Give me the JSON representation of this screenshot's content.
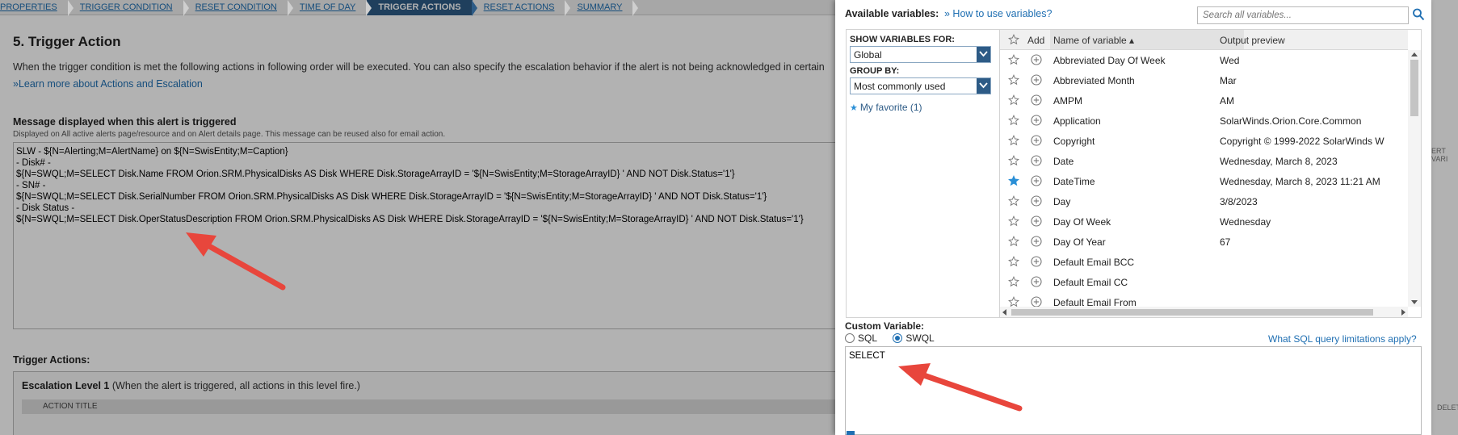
{
  "wizard_steps": [
    "PROPERTIES",
    "TRIGGER CONDITION",
    "RESET CONDITION",
    "TIME OF DAY",
    "TRIGGER ACTIONS",
    "RESET ACTIONS",
    "SUMMARY"
  ],
  "wizard_active": "TRIGGER ACTIONS",
  "page": {
    "title": "5. Trigger Action",
    "intro": "When the trigger condition is met the following actions in following order will be executed. You can also specify the escalation behavior if the alert is not being acknowledged in certain",
    "learn_link": "»Learn more about Actions and Escalation",
    "message_label": "Message displayed when this alert is triggered",
    "message_sub": "Displayed on All active alerts page/resource and on Alert details page. This message can be reused also for email action.",
    "message_lines": [
      "SLW - ${N=Alerting;M=AlertName} on ${N=SwisEntity;M=Caption}",
      "- Disk# -",
      "${N=SWQL;M=SELECT Disk.Name FROM Orion.SRM.PhysicalDisks AS Disk WHERE Disk.StorageArrayID = '${N=SwisEntity;M=StorageArrayID} ' AND NOT Disk.Status='1'}",
      "- SN# -",
      "${N=SWQL;M=SELECT Disk.SerialNumber FROM Orion.SRM.PhysicalDisks AS Disk WHERE Disk.StorageArrayID = '${N=SwisEntity;M=StorageArrayID} ' AND NOT Disk.Status='1'}",
      "- Disk Status -",
      "${N=SWQL;M=SELECT Disk.OperStatusDescription FROM Orion.SRM.PhysicalDisks AS Disk WHERE Disk.StorageArrayID = '${N=SwisEntity;M=StorageArrayID} ' AND NOT Disk.Status='1'}"
    ],
    "trigger_actions_label": "Trigger Actions:",
    "escalation_title": "Escalation Level 1",
    "escalation_note": "(When the alert is triggered, all actions in this level fire.)",
    "action_title_header": "ACTION TITLE",
    "right_peek_1": "ERT VARI",
    "right_peek_2": "DELETE"
  },
  "dialog": {
    "available_label": "Available variables:",
    "how_to_link": "» How to use variables?",
    "search_placeholder": "Search all variables...",
    "show_for_label": "SHOW VARIABLES FOR:",
    "show_for_value": "Global",
    "group_by_label": "GROUP BY:",
    "group_by_value": "Most commonly used",
    "favorite": "My favorite (1)",
    "columns": {
      "add": "Add",
      "name": "Name of variable ▴",
      "preview": "Output preview"
    },
    "rows": [
      {
        "name": "Abbreviated Day Of Week",
        "preview": "Wed",
        "fav": false
      },
      {
        "name": "Abbreviated Month",
        "preview": "Mar",
        "fav": false
      },
      {
        "name": "AMPM",
        "preview": "AM",
        "fav": false
      },
      {
        "name": "Application",
        "preview": "SolarWinds.Orion.Core.Common",
        "fav": false
      },
      {
        "name": "Copyright",
        "preview": "Copyright © 1999-2022 SolarWinds W",
        "fav": false
      },
      {
        "name": "Date",
        "preview": "Wednesday, March 8, 2023",
        "fav": false
      },
      {
        "name": "DateTime",
        "preview": "Wednesday, March 8, 2023 11:21 AM",
        "fav": true
      },
      {
        "name": "Day",
        "preview": "3/8/2023",
        "fav": false
      },
      {
        "name": "Day Of Week",
        "preview": "Wednesday",
        "fav": false
      },
      {
        "name": "Day Of Year",
        "preview": "67",
        "fav": false
      },
      {
        "name": "Default Email BCC",
        "preview": "",
        "fav": false
      },
      {
        "name": "Default Email CC",
        "preview": "",
        "fav": false
      },
      {
        "name": "Default Email From",
        "preview": "",
        "fav": false
      }
    ],
    "custom_label": "Custom Variable:",
    "radio_sql": "SQL",
    "radio_swql": "SWQL",
    "sql_link": "What SQL query limitations apply?",
    "custom_value": "SELECT"
  },
  "colors": {
    "link": "#1f6fb2",
    "active_step": "#2d5b86",
    "arrow": "#e8463c",
    "fav_star": "#2a8fd6"
  }
}
